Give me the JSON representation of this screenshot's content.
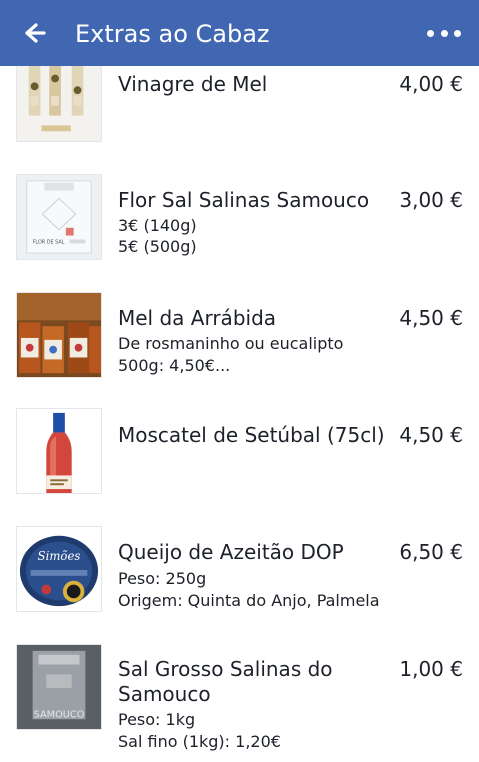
{
  "appbar": {
    "title": "Extras ao Cabaz",
    "back_icon": "arrow-left-icon",
    "more_icon": "more-horizontal-icon",
    "background_color": "#4267b2"
  },
  "items": [
    {
      "name": "Vinagre de Mel",
      "price": "4,00 €",
      "lines": []
    },
    {
      "name": "Flor Sal Salinas Samouco",
      "price": "3,00 €",
      "lines": [
        "3€ (140g)",
        "5€ (500g)"
      ]
    },
    {
      "name": "Mel da Arrábida",
      "price": "4,50 €",
      "lines": [
        "De rosmaninho ou eucalipto",
        "500g: 4,50€..."
      ]
    },
    {
      "name": "Moscatel de Setúbal (75cl)",
      "price": "4,50 €",
      "lines": []
    },
    {
      "name": "Queijo de Azeitão DOP",
      "price": "6,50 €",
      "lines": [
        "Peso: 250g",
        "Origem: Quinta do Anjo, Palmela"
      ]
    },
    {
      "name": "Sal Grosso Salinas do Samouco",
      "price": "1,00 €",
      "lines": [
        "Peso: 1kg",
        "Sal fino (1kg): 1,20€"
      ]
    }
  ],
  "image_text": {
    "flor_sal_label": "FLOR DE SAL",
    "queijo_brand": "Simões",
    "sal_grosso_label": "SAMOUCO"
  }
}
